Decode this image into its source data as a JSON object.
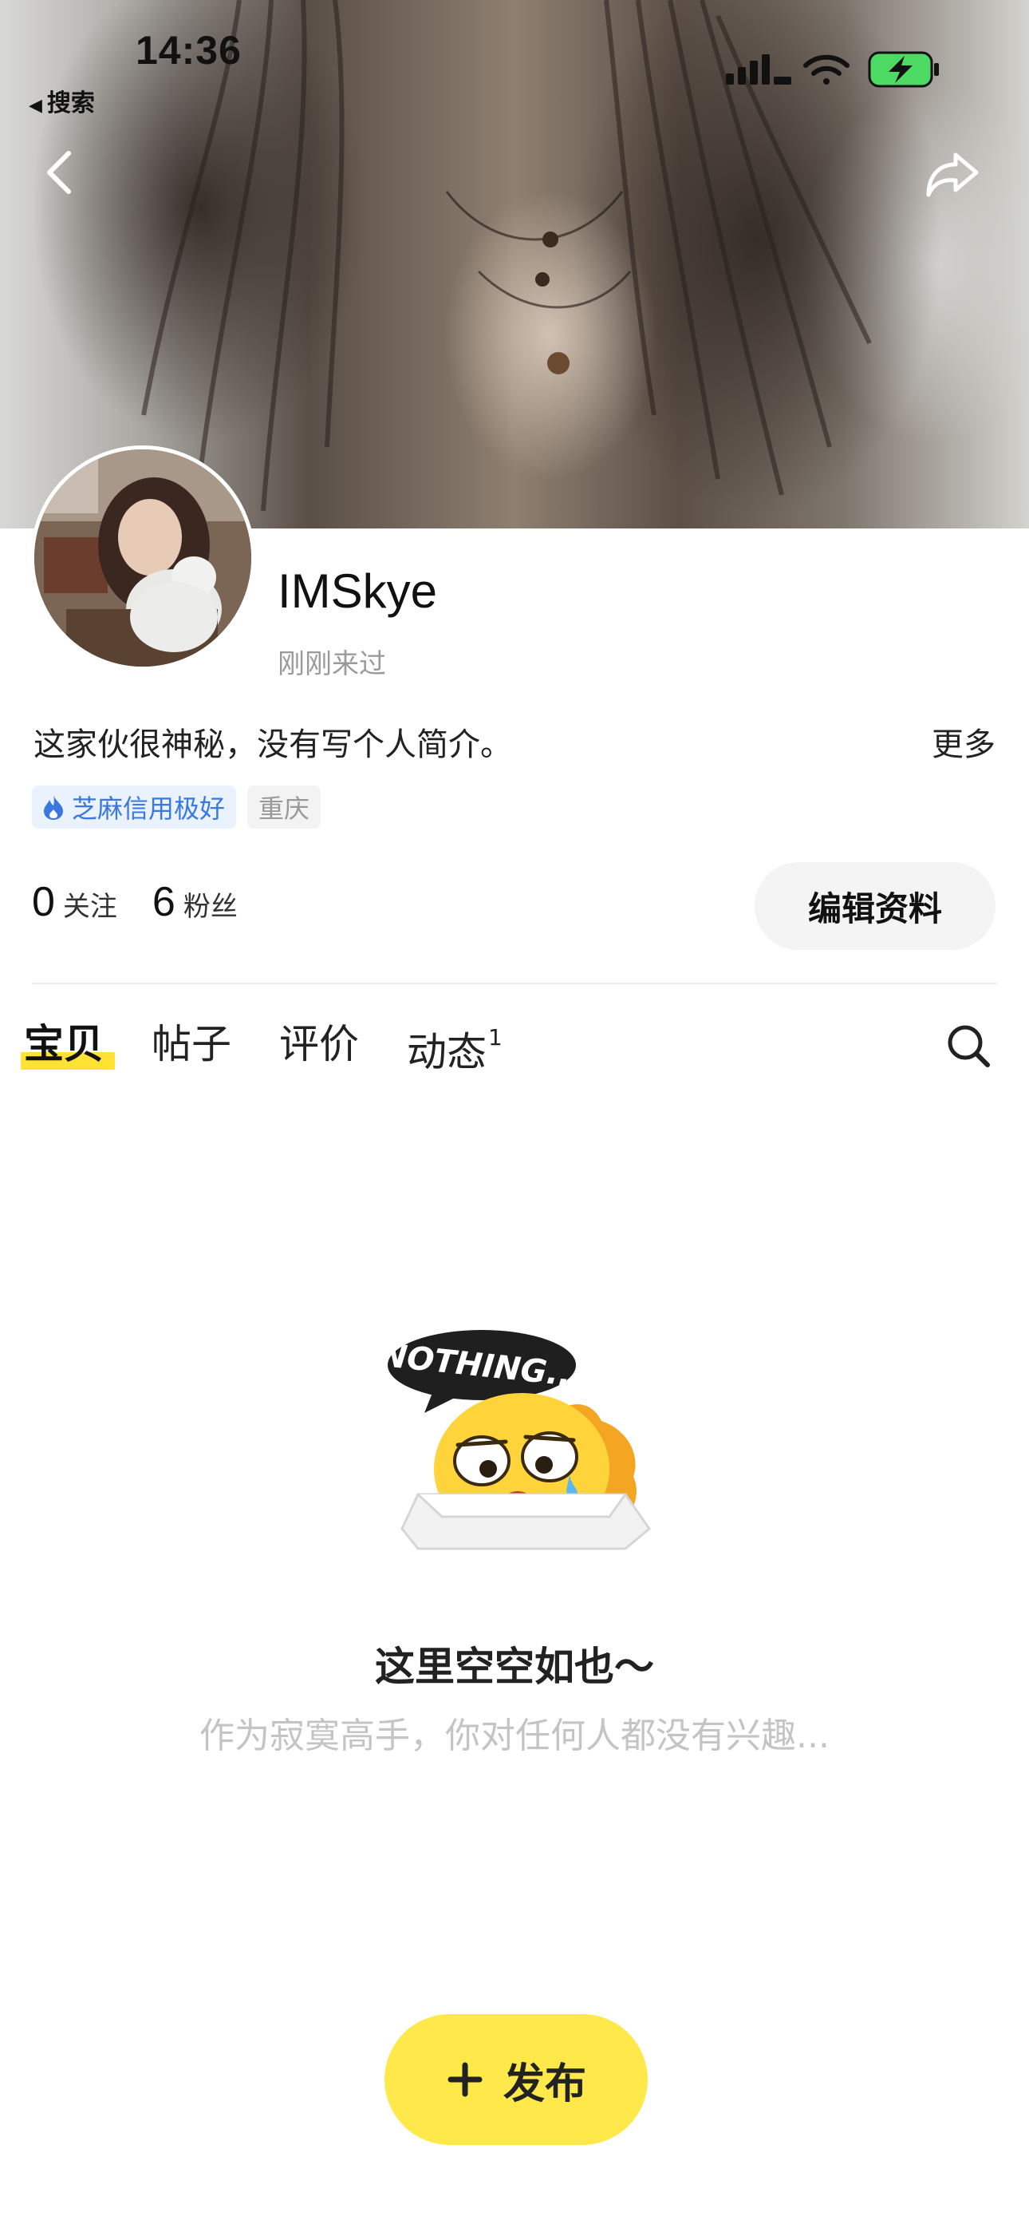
{
  "status_bar": {
    "time": "14:36",
    "back_app_label": "搜索",
    "icons": [
      "cellular-signal-icon",
      "wifi-icon",
      "battery-charging-icon"
    ]
  },
  "nav": {
    "icons": [
      "back-chevron-icon",
      "share-icon"
    ]
  },
  "profile": {
    "username": "IMSkye",
    "last_seen": "刚刚来过",
    "bio": "这家伙很神秘，没有写个人简介。",
    "more_label": "更多",
    "tags": {
      "credit": "芝麻信用极好",
      "city": "重庆"
    },
    "stats": [
      {
        "count": "0",
        "label": "关注"
      },
      {
        "count": "6",
        "label": "粉丝"
      }
    ],
    "edit_button": "编辑资料"
  },
  "tabs": [
    {
      "label": "宝贝",
      "active": true
    },
    {
      "label": "帖子"
    },
    {
      "label": "评价"
    },
    {
      "label": "动态",
      "badge": "1"
    }
  ],
  "empty_state": {
    "illustration_text": "NOTHING...",
    "title": "这里空空如也～",
    "subtitle": "作为寂寞高手，你对任何人都没有兴趣..."
  },
  "publish_button": "发布",
  "colors": {
    "accent_yellow": "#ffe84a",
    "credit_blue": "#3a78e0",
    "battery_green": "#4cd964"
  }
}
